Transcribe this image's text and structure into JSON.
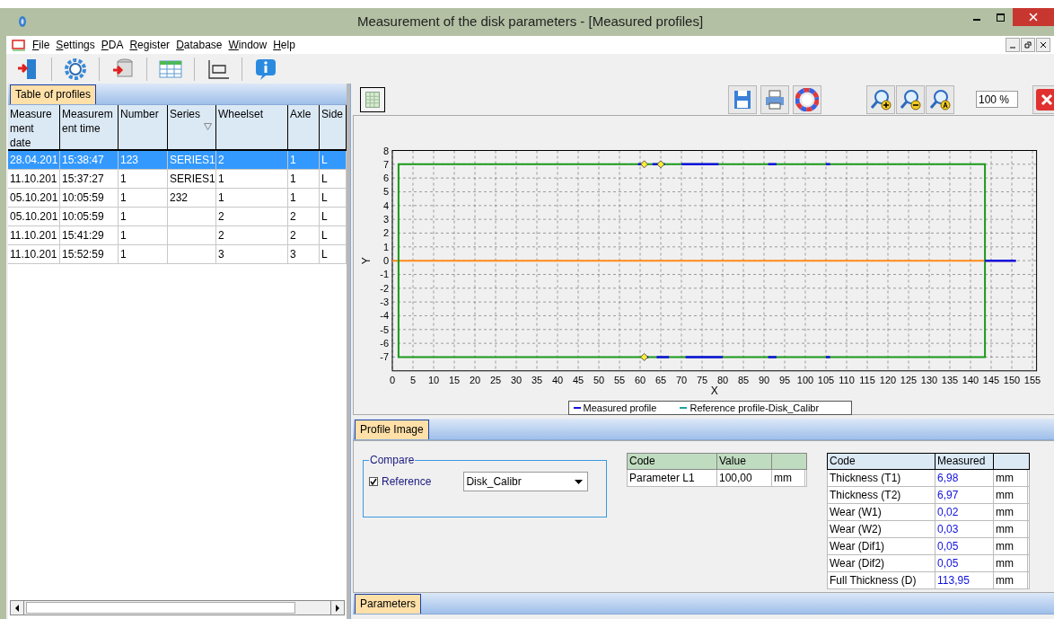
{
  "window": {
    "title": "Measurement of the disk parameters - [Measured profiles]"
  },
  "menu": [
    "File",
    "Settings",
    "PDA",
    "Register",
    "Database",
    "Window",
    "Help"
  ],
  "left_panel": {
    "tab": "Table of profiles",
    "columns": [
      {
        "label": "Measurement date",
        "filter": false
      },
      {
        "label": "Measurement time",
        "filter": false
      },
      {
        "label": "Number",
        "filter": false
      },
      {
        "label": "Series",
        "filter": true
      },
      {
        "label": "Wheelset",
        "filter": false
      },
      {
        "label": "Axle",
        "filter": false
      },
      {
        "label": "Side",
        "filter": false
      }
    ],
    "rows": [
      {
        "selected": true,
        "cells": [
          "28.04.201",
          "15:38:47",
          "123",
          "SERIES1",
          "2",
          "1",
          "L"
        ]
      },
      {
        "selected": false,
        "cells": [
          "11.10.201",
          "15:37:27",
          "1",
          "SERIES1",
          "1",
          "1",
          "L"
        ]
      },
      {
        "selected": false,
        "cells": [
          "05.10.201",
          "10:05:59",
          "1",
          "232",
          "1",
          "1",
          "L"
        ]
      },
      {
        "selected": false,
        "cells": [
          "05.10.201",
          "10:05:59",
          "1",
          "",
          "2",
          "2",
          "L"
        ]
      },
      {
        "selected": false,
        "cells": [
          "11.10.201",
          "15:41:29",
          "1",
          "",
          "2",
          "2",
          "L"
        ]
      },
      {
        "selected": false,
        "cells": [
          "11.10.201",
          "15:52:59",
          "1",
          "",
          "3",
          "3",
          "L"
        ]
      }
    ]
  },
  "right_panel": {
    "zoom": "100 %",
    "profile_plot": {
      "xlabel": "X",
      "ylabel": "Y",
      "x_tick_labels": [
        "0",
        "5",
        "10",
        "15",
        "20",
        "25",
        "30",
        "35",
        "40",
        "45",
        "50",
        "55",
        "60",
        "65",
        "70",
        "75",
        "80",
        "85",
        "90",
        "95",
        "100",
        "105",
        "110",
        "115",
        "120",
        "125",
        "130",
        "135",
        "140",
        "145",
        "150",
        "155"
      ],
      "y_tick_labels": [
        "8",
        "7",
        "6",
        "5",
        "4",
        "3",
        "2",
        "1",
        "0",
        "-1",
        "-2",
        "-3",
        "-4",
        "-5",
        "-6",
        "-7"
      ],
      "legend": [
        {
          "label": "Measured profile",
          "color": "#1010e0"
        },
        {
          "label": "Reference profile-Disk_Calibr",
          "color": "#20a0a0"
        }
      ]
    },
    "image_tab": "Profile Image",
    "compare": {
      "title": "Compare",
      "label": "Reference",
      "checked": true,
      "value": "Disk_Calibr"
    },
    "param_table": {
      "columns": [
        "Code",
        "Value"
      ],
      "rows": [
        [
          "Parameter L1",
          "100,00",
          "mm"
        ]
      ]
    },
    "measured_table": {
      "columns": [
        "Code",
        "Measured"
      ],
      "rows": [
        [
          "Thickness (T1)",
          "6,98",
          "mm"
        ],
        [
          "Thickness (T2)",
          "6,97",
          "mm"
        ],
        [
          "Wear (W1)",
          "0,02",
          "mm"
        ],
        [
          "Wear (W2)",
          "0,03",
          "mm"
        ],
        [
          "Wear (Dif1)",
          "0,05",
          "mm"
        ],
        [
          "Wear (Dif2)",
          "0,05",
          "mm"
        ],
        [
          "Full Thickness (D)",
          "113,95",
          "mm"
        ]
      ]
    },
    "params_tab": "Parameters"
  }
}
